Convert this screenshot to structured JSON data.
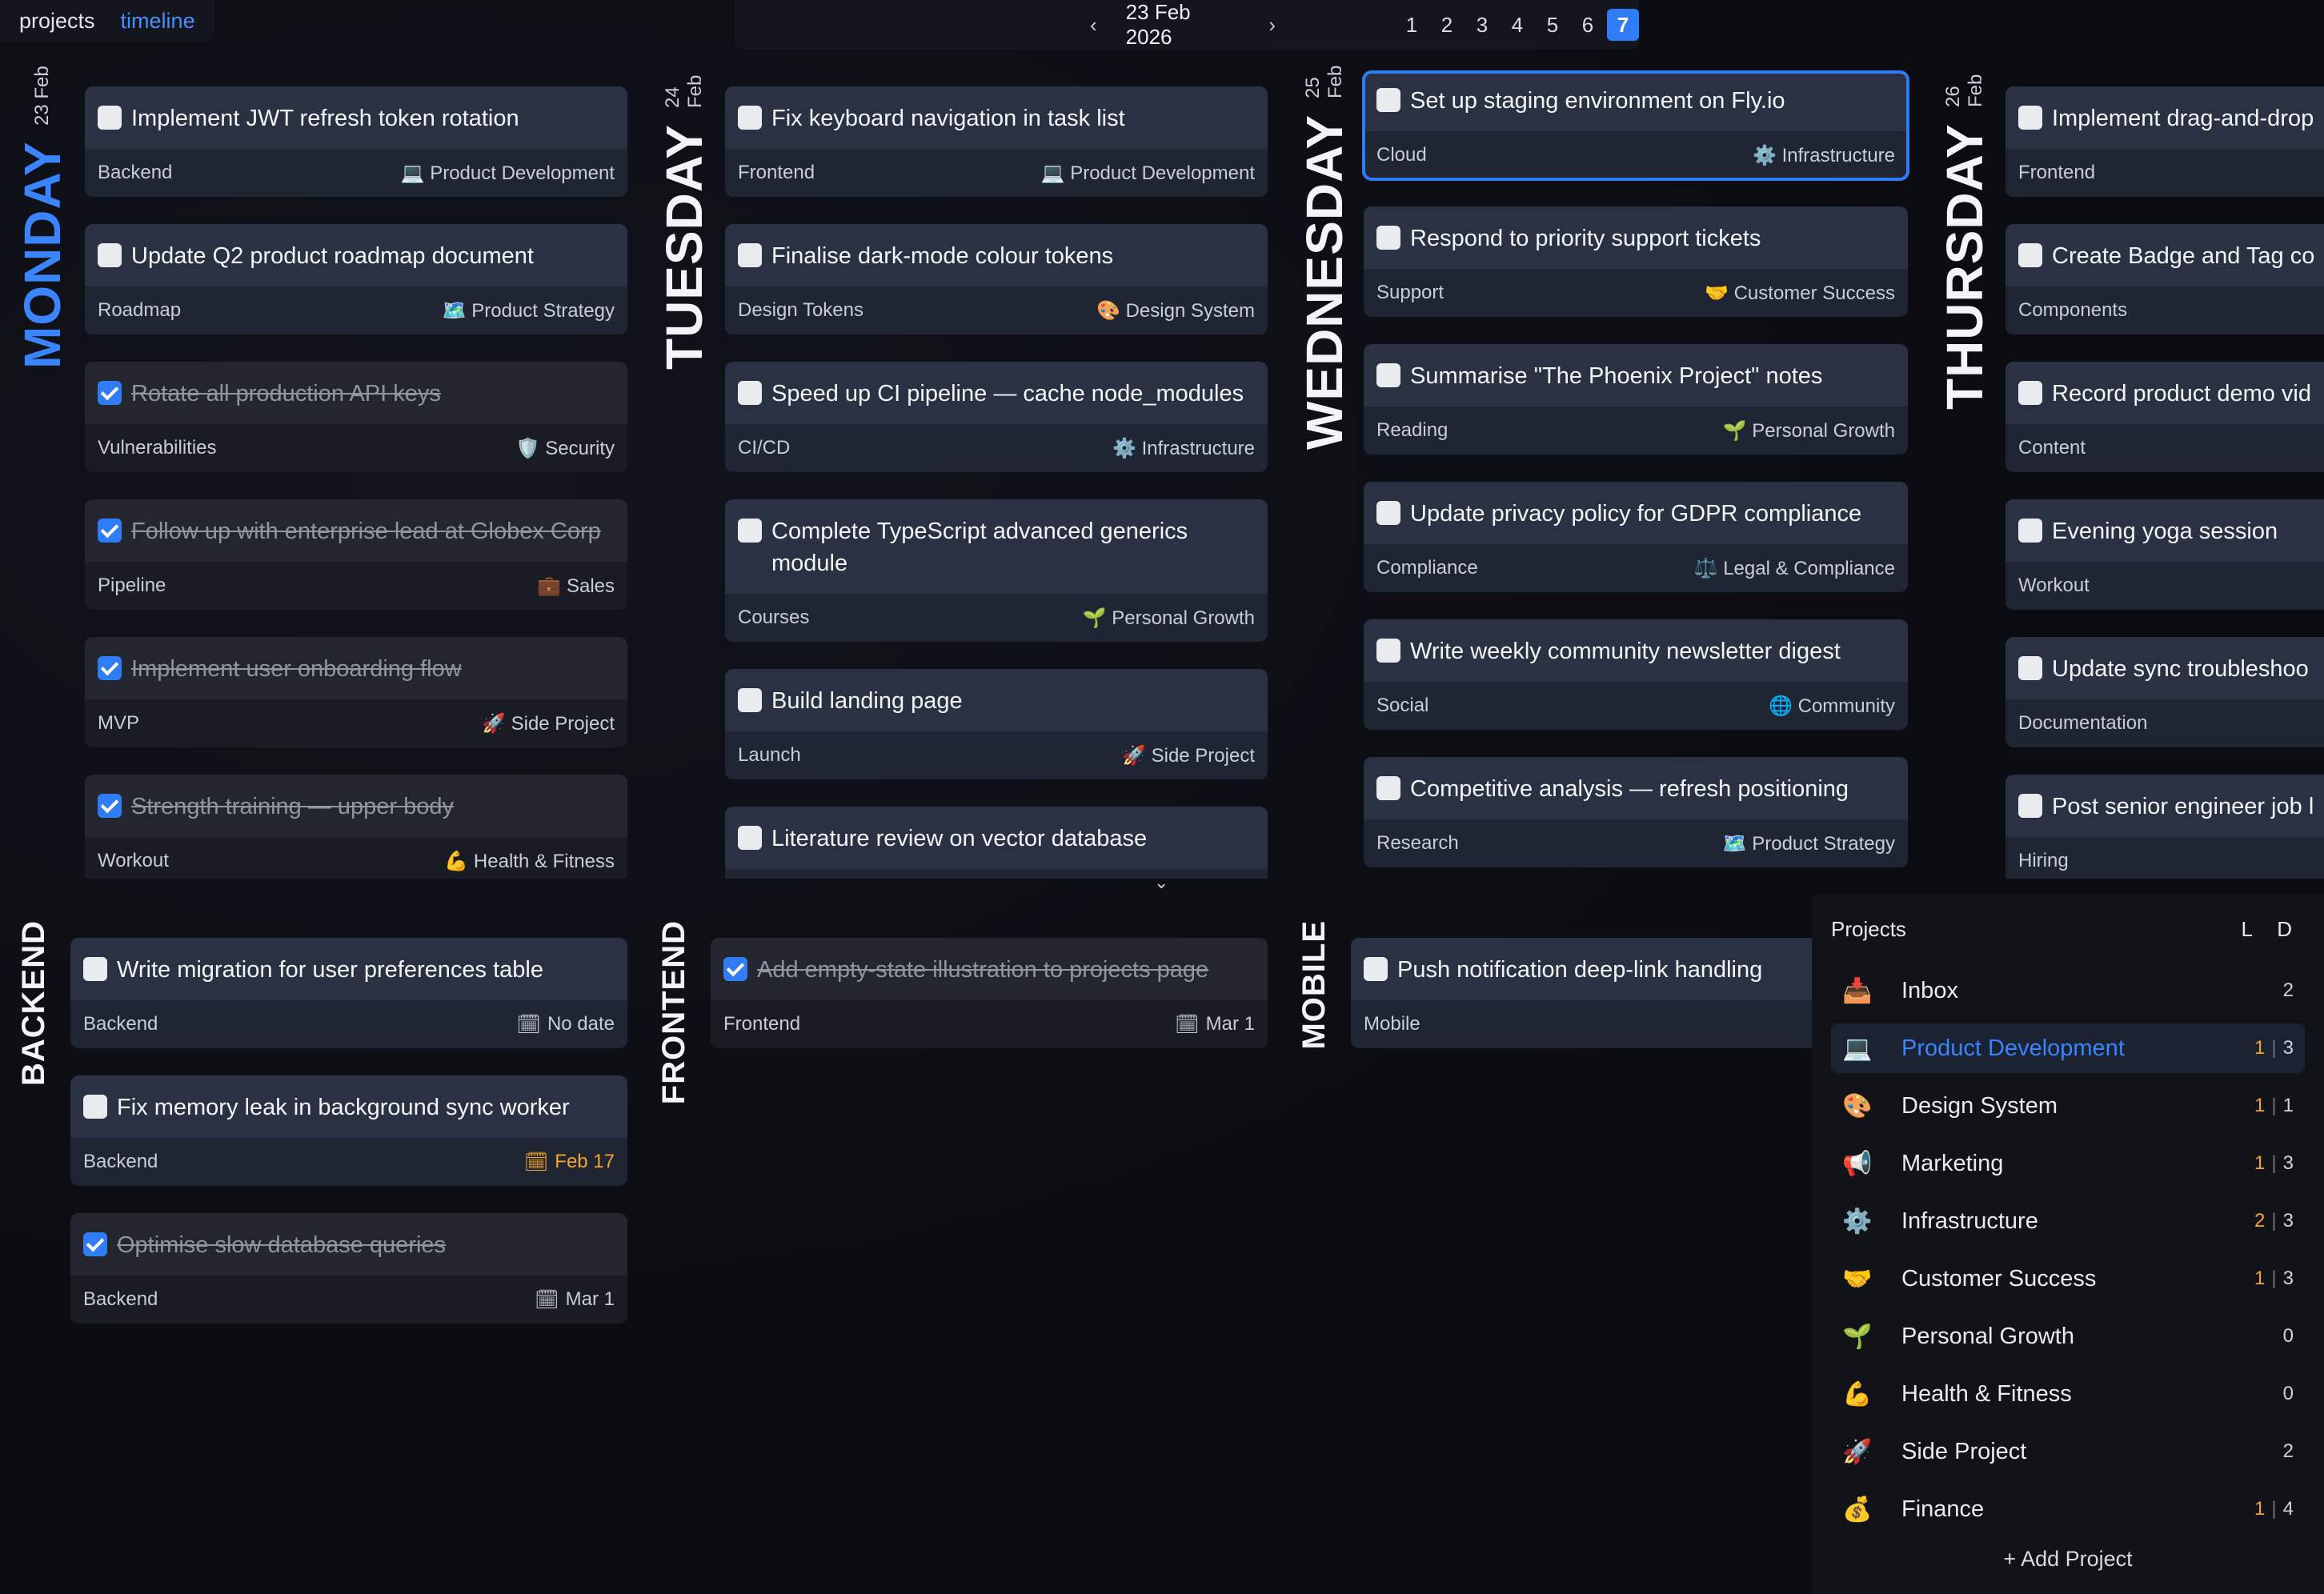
{
  "views": [
    "projects",
    "timeline"
  ],
  "nav": {
    "date": "23 Feb 2026",
    "prev": "‹",
    "next": "›",
    "pages": [
      "1",
      "2",
      "3",
      "4",
      "5",
      "6",
      "7"
    ]
  },
  "days": [
    {
      "name": "MONDAY",
      "date": "23 Feb"
    },
    {
      "name": "TUESDAY",
      "date": "24 Feb"
    },
    {
      "name": "WEDNESDAY",
      "date": "25 Feb"
    },
    {
      "name": "THURSDAY",
      "date": "26 Feb"
    }
  ],
  "monday": [
    {
      "title": "Implement JWT refresh token rotation",
      "tag": "Backend",
      "project": "💻 Product Development"
    },
    {
      "title": "Update Q2 product roadmap document",
      "tag": "Roadmap",
      "project": "🗺️ Product Strategy"
    },
    {
      "title": "Rotate all production API keys",
      "tag": "Vulnerabilities",
      "project": "🛡️ Security"
    },
    {
      "title": "Follow up with enterprise lead at Globex Corp",
      "tag": "Pipeline",
      "project": "💼 Sales"
    },
    {
      "title": "Implement user onboarding flow",
      "tag": "MVP",
      "project": "🚀 Side Project"
    },
    {
      "title": "Strength training — upper body",
      "tag": "Workout",
      "project": "💪 Health & Fitness"
    }
  ],
  "tuesday": [
    {
      "title": "Fix keyboard navigation in task list",
      "tag": "Frontend",
      "project": "💻 Product Development"
    },
    {
      "title": "Finalise dark-mode colour tokens",
      "tag": "Design Tokens",
      "project": "🎨 Design System"
    },
    {
      "title": "Speed up CI pipeline — cache node_modules",
      "tag": "CI/CD",
      "project": "⚙️ Infrastructure"
    },
    {
      "title": "Complete TypeScript advanced generics module",
      "tag": "Courses",
      "project": "🌱 Personal Growth"
    },
    {
      "title": "Build landing page",
      "tag": "Launch",
      "project": "🚀 Side Project"
    },
    {
      "title": "Literature review on vector database",
      "tag": "",
      "project": ""
    }
  ],
  "wednesday": [
    {
      "title": "Set up staging environment on Fly.io",
      "tag": "Cloud",
      "project": "⚙️ Infrastructure"
    },
    {
      "title": "Respond to priority support tickets",
      "tag": "Support",
      "project": "🤝 Customer Success"
    },
    {
      "title": "Summarise \"The Phoenix Project\" notes",
      "tag": "Reading",
      "project": "🌱 Personal Growth"
    },
    {
      "title": "Update privacy policy for GDPR compliance",
      "tag": "Compliance",
      "project": "⚖️ Legal & Compliance"
    },
    {
      "title": "Write weekly community newsletter digest",
      "tag": "Social",
      "project": "🌐 Community"
    },
    {
      "title": "Competitive analysis — refresh positioning",
      "tag": "Research",
      "project": "🗺️ Product Strategy"
    }
  ],
  "thursday": [
    {
      "title": "Implement drag-and-drop",
      "tag": "Frontend"
    },
    {
      "title": "Create Badge and Tag co",
      "tag": "Components"
    },
    {
      "title": "Record product demo vid",
      "tag": "Content"
    },
    {
      "title": "Evening yoga session",
      "tag": "Workout"
    },
    {
      "title": "Update sync troubleshoo",
      "tag": "Documentation"
    },
    {
      "title": "Post senior engineer job l",
      "tag": "Hiring"
    }
  ],
  "lanes": [
    "BACKEND",
    "FRONTEND",
    "MOBILE"
  ],
  "backend": [
    {
      "title": "Write migration for user preferences table",
      "tag": "Backend",
      "due": "No date"
    },
    {
      "title": "Fix memory leak in background sync worker",
      "tag": "Backend",
      "due": "Feb 17"
    },
    {
      "title": "Optimise slow database queries",
      "tag": "Backend",
      "due": "Mar 1"
    }
  ],
  "frontend": [
    {
      "title": "Add empty-state illustration to projects page",
      "tag": "Frontend",
      "due": "Mar 1"
    }
  ],
  "mobile": [
    {
      "title": "Push notification deep-link handling",
      "tag": "Mobile",
      "due": ""
    }
  ],
  "panel": {
    "title": "Projects",
    "cols": "L D",
    "add": "+ Add Project",
    "projects": [
      {
        "icon": "📥",
        "name": "Inbox",
        "l": "",
        "d": "2"
      },
      {
        "icon": "💻",
        "name": "Product Development",
        "l": "1",
        "d": "3"
      },
      {
        "icon": "🎨",
        "name": "Design System",
        "l": "1",
        "d": "1"
      },
      {
        "icon": "📢",
        "name": "Marketing",
        "l": "1",
        "d": "3"
      },
      {
        "icon": "⚙️",
        "name": "Infrastructure",
        "l": "2",
        "d": "3"
      },
      {
        "icon": "🤝",
        "name": "Customer Success",
        "l": "1",
        "d": "3"
      },
      {
        "icon": "🌱",
        "name": "Personal Growth",
        "l": "",
        "d": "0"
      },
      {
        "icon": "💪",
        "name": "Health & Fitness",
        "l": "",
        "d": "0"
      },
      {
        "icon": "🚀",
        "name": "Side Project",
        "l": "",
        "d": "2"
      },
      {
        "icon": "💰",
        "name": "Finance",
        "l": "1",
        "d": "4"
      }
    ]
  },
  "colors": {
    "accent": "#2f7cf6",
    "due_overdue": "#f5a524"
  }
}
